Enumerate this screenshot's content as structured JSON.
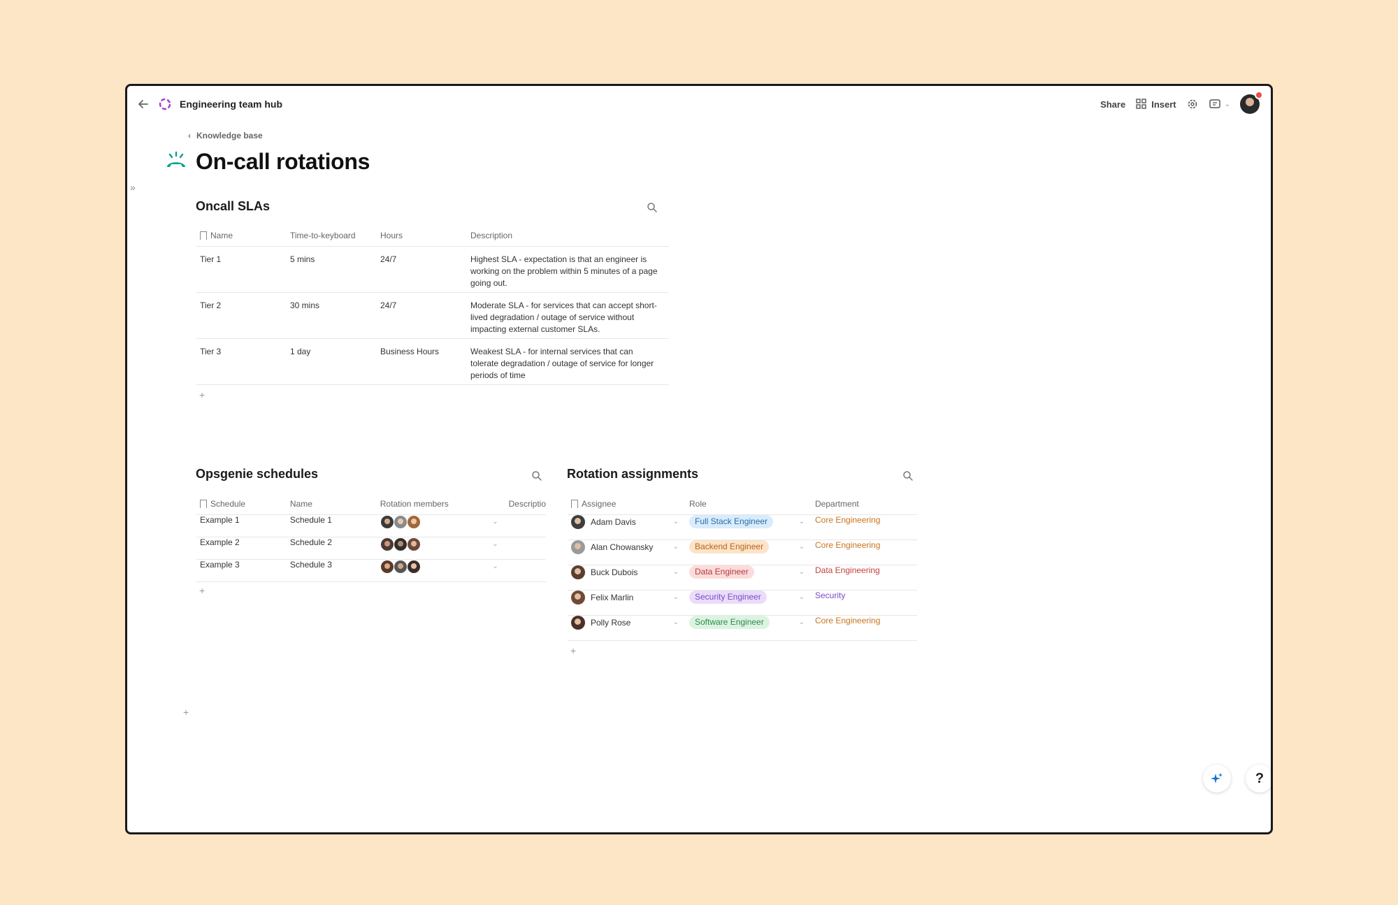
{
  "topbar": {
    "doc_title": "Engineering team hub",
    "share_label": "Share",
    "insert_label": "Insert"
  },
  "breadcrumb": {
    "label": "Knowledge base"
  },
  "page": {
    "title": "On-call rotations"
  },
  "sla": {
    "title": "Oncall SLAs",
    "columns": [
      "Name",
      "Time-to-keyboard",
      "Hours",
      "Description"
    ],
    "rows": [
      {
        "name": "Tier 1",
        "ttk": "5 mins",
        "hours": "24/7",
        "desc": "Highest SLA - expectation is that an engineer is working on the problem within 5 minutes of a page going out."
      },
      {
        "name": "Tier 2",
        "ttk": "30 mins",
        "hours": "24/7",
        "desc": "Moderate SLA - for services that can accept short-lived degradation / outage of service without impacting external customer SLAs."
      },
      {
        "name": "Tier 3",
        "ttk": "1 day",
        "hours": "Business Hours",
        "desc": "Weakest SLA - for internal services that can tolerate degradation / outage of service for longer periods of time"
      }
    ]
  },
  "schedules": {
    "title": "Opsgenie schedules",
    "columns": [
      "Schedule",
      "Name",
      "Rotation members",
      "Descriptio"
    ],
    "rows": [
      {
        "schedule": "Example 1",
        "name": "Schedule 1"
      },
      {
        "schedule": "Example 2",
        "name": "Schedule 2"
      },
      {
        "schedule": "Example 3",
        "name": "Schedule 3"
      }
    ]
  },
  "assignments": {
    "title": "Rotation assignments",
    "columns": [
      "Assignee",
      "Role",
      "Department"
    ],
    "rows": [
      {
        "assignee": "Adam Davis",
        "role": "Full Stack Engineer",
        "department": "Core Engineering"
      },
      {
        "assignee": "Alan Chowansky",
        "role": "Backend Engineer",
        "department": "Core Engineering"
      },
      {
        "assignee": "Buck Dubois",
        "role": "Data Engineer",
        "department": "Data Engineering"
      },
      {
        "assignee": "Felix Marlin",
        "role": "Security Engineer",
        "department": "Security"
      },
      {
        "assignee": "Polly Rose",
        "role": "Software Engineer",
        "department": "Core Engineering"
      }
    ]
  },
  "colors": {
    "background": "#fde6c6",
    "accent_teal": "#0f9f8f",
    "role_full_stack": "#d9ecfb",
    "role_backend": "#fde3c8",
    "role_data": "#fbdcdc",
    "role_security": "#eadcfa",
    "role_software": "#dcf3e2",
    "dept_core": "#c8741c",
    "dept_data": "#c2413f",
    "dept_security": "#7b4bc4"
  },
  "icons": [
    "back-arrow-icon",
    "doc-logo-icon",
    "insert-grid-icon",
    "gear-icon",
    "comment-icon",
    "chevron-down-icon",
    "pager-icon",
    "search-icon",
    "sparkle-icon",
    "help-icon"
  ]
}
